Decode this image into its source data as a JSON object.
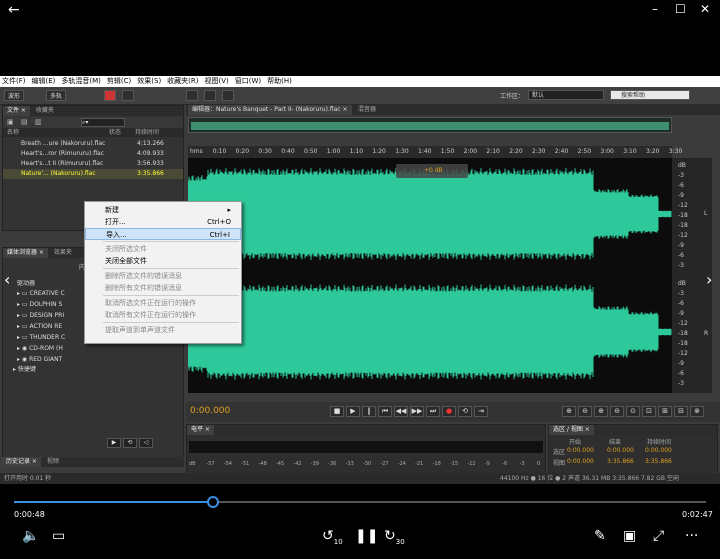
{
  "app": {
    "menu": [
      "文件(F)",
      "编辑(E)",
      "多轨混音(M)",
      "剪辑(C)",
      "效果(S)",
      "收藏夹(R)",
      "视图(V)",
      "窗口(W)",
      "帮助(H)"
    ],
    "toolbar": {
      "waveform": "波形",
      "multitrack": "多轨",
      "workspace_label": "工作区：",
      "workspace_value": "默认",
      "search_placeholder": "搜索帮助"
    },
    "files_panel": {
      "tabs": [
        "文件 ×",
        "收藏夹"
      ],
      "headers": {
        "name": "名称",
        "status": "状态",
        "duration": "持续时间"
      },
      "rows": [
        {
          "name": "Breath ...ure (Nakoruru).flac",
          "duration": "4:13.266"
        },
        {
          "name": "Heart's...ror (Rimururu).flac",
          "duration": "4:09.933"
        },
        {
          "name": "Heart's...t II (Rimururu).flac",
          "duration": "3:56.933"
        },
        {
          "name": "Nature'... (Nakoruru).flac",
          "duration": "3:35.866"
        }
      ]
    },
    "media_panel": {
      "tabs": [
        "媒体浏览器 ×",
        "效果夹"
      ],
      "content_label": "内容",
      "drives_label": "驱动器",
      "items": [
        "CREATIVE C",
        "DOLPHIN S",
        "DESIGN PRI",
        "ACTION RE",
        "THUNDER C",
        "CD-ROM (H",
        "RED GIANT"
      ],
      "shortcuts": "快捷键"
    },
    "editor": {
      "tab": "编辑器：Nature's Banquet - Part II- (Nakoruru).flac ×",
      "mixer_tab": "混音器",
      "ruler": [
        "hms",
        "0:10",
        "0:20",
        "0:30",
        "0:40",
        "0:50",
        "1:00",
        "1:10",
        "1:20",
        "1:30",
        "1:40",
        "1:50",
        "2:00",
        "2:10",
        "2:20",
        "2:30",
        "2:40",
        "2:50",
        "3:00",
        "3:10",
        "3:20",
        "3:30"
      ],
      "hud": "+0 dB",
      "db_top": [
        "dB",
        "-3",
        "-6",
        "-9",
        "-12",
        "-18",
        "-18",
        "-12",
        "-9",
        "-6",
        "-3"
      ],
      "db_bottom": [
        "dB",
        "-3",
        "-6",
        "-9",
        "-12",
        "-18",
        "-18",
        "-12",
        "-9",
        "-6",
        "-3"
      ],
      "ch1": "L",
      "ch2": "R"
    },
    "transport": {
      "time": "0:00.000"
    },
    "level_panel": {
      "tab": "电平 ×",
      "scale": [
        "dB",
        "-57",
        "-54",
        "-51",
        "-48",
        "-45",
        "-42",
        "-39",
        "-36",
        "-33",
        "-30",
        "-27",
        "-24",
        "-21",
        "-18",
        "-15",
        "-12",
        "-9",
        "-6",
        "-3",
        "0"
      ]
    },
    "selection_panel": {
      "tab": "选区 / 视图 ×",
      "headers": [
        "开始",
        "结束",
        "持续时间"
      ],
      "rows": [
        {
          "label": "选区",
          "start": "0:00.000",
          "end": "0:00.000",
          "dur": "0:00.000"
        },
        {
          "label": "视图",
          "start": "0:00.000",
          "end": "3:35.866",
          "dur": "3:35.866"
        }
      ]
    },
    "history_tabs": [
      "历史记录 ×",
      "视频"
    ],
    "status": {
      "left": "打开用时 0.01 秒",
      "right": "44100 Hz ● 16 位 ● 2 声道    36.31 MB    3:35.866    7.82 GB 空闲"
    },
    "context_menu": {
      "items": [
        {
          "label": "新建",
          "shortcut": "",
          "submenu": true,
          "disabled": false
        },
        {
          "label": "打开...",
          "shortcut": "Ctrl+O",
          "disabled": false
        },
        {
          "label": "导入...",
          "shortcut": "Ctrl+I",
          "disabled": false,
          "highlighted": true
        },
        {
          "label": "关闭所选文件",
          "shortcut": "",
          "disabled": true
        },
        {
          "label": "关闭全部文件",
          "shortcut": "",
          "disabled": false
        },
        {
          "label": "删除所选文件的错误消息",
          "shortcut": "",
          "disabled": true
        },
        {
          "label": "删除所有文件的错误消息",
          "shortcut": "",
          "disabled": true
        },
        {
          "label": "取消所选文件正在运行的操作",
          "shortcut": "",
          "disabled": true
        },
        {
          "label": "取消所有文件正在运行的操作",
          "shortcut": "",
          "disabled": true
        },
        {
          "label": "提取声道到单声道文件",
          "shortcut": "",
          "disabled": true
        }
      ]
    }
  },
  "player": {
    "current": "0:00:48",
    "total": "0:02:47",
    "progress": 0.287,
    "back_icon": "back-arrow-icon",
    "rewind_label": "10",
    "forward_label": "30",
    "colors": {
      "accent": "#3a8ee6",
      "wave": "#2ec99a"
    }
  }
}
